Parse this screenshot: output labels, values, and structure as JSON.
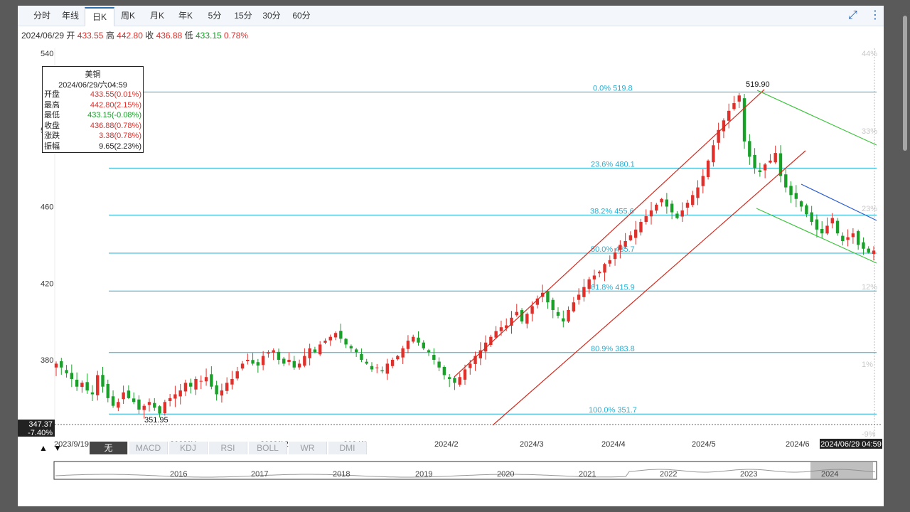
{
  "tabs": [
    {
      "label": "分时",
      "active": false
    },
    {
      "label": "年线",
      "active": false
    },
    {
      "label": "日K",
      "active": true
    },
    {
      "label": "周K",
      "active": false
    },
    {
      "label": "月K",
      "active": false
    },
    {
      "label": "年K",
      "active": false
    },
    {
      "label": "5分",
      "active": false
    },
    {
      "label": "15分",
      "active": false
    },
    {
      "label": "30分",
      "active": false
    },
    {
      "label": "60分",
      "active": false
    }
  ],
  "icons": {
    "collapse": "collapse-arrows-icon",
    "more": "vertical-dots-icon"
  },
  "info": {
    "date": "2024/06/29",
    "open_label": "开",
    "open": "433.55",
    "high_label": "高",
    "high": "442.80",
    "close_label": "收",
    "close": "436.88",
    "low_label": "低",
    "low": "433.15",
    "change": "0.78%"
  },
  "ohlc_box": {
    "title": "美铜",
    "datetime": "2024/06/29/六04:59",
    "rows": [
      {
        "k": "开盘",
        "v": "433.55(0.01%)",
        "color": "red"
      },
      {
        "k": "最高",
        "v": "442.80(2.15%)",
        "color": "red"
      },
      {
        "k": "最低",
        "v": "433.15(-0.08%)",
        "color": "green"
      },
      {
        "k": "收盘",
        "v": "436.88(0.78%)",
        "color": "red"
      },
      {
        "k": "涨跌",
        "v": "3.38(0.78%)",
        "color": "red"
      },
      {
        "k": "振幅",
        "v": "9.65(2.23%)",
        "color": "black"
      }
    ]
  },
  "colors": {
    "up": "#e0302b",
    "down": "#18a028",
    "fib": "#22b0d6",
    "channel_red": "#d42a1e",
    "channel_green": "#3cc43c",
    "channel_blue": "#2a5fd0"
  },
  "chart_data": {
    "type": "candlestick",
    "y_axis": {
      "ticks": [
        540,
        500,
        460,
        420,
        380
      ],
      "ylim": [
        341,
        547
      ]
    },
    "right_axis_ticks": [
      "44%",
      "33%",
      "23%",
      "12%",
      "1%",
      "-9%"
    ],
    "x_labels": [
      "2023/9/19",
      "2023/11",
      "2023/12",
      "2024/1",
      "2024/2",
      "2024/3",
      "2024/4",
      "2024/5",
      "2024/6"
    ],
    "crosshair": {
      "price": "347.37",
      "pct": "-7.40%",
      "date": "2024/06/29 04:59"
    },
    "annotations": {
      "high": "519.90",
      "low": "351.95"
    },
    "fibonacci": [
      {
        "label": "0.0% 519.8",
        "value": 519.8
      },
      {
        "label": "23.6% 480.1",
        "value": 480.1
      },
      {
        "label": "38.2% 455.6",
        "value": 455.6
      },
      {
        "label": "50.0% 435.7",
        "value": 435.7
      },
      {
        "label": "61.8% 415.9",
        "value": 415.9
      },
      {
        "label": "80.9% 383.8",
        "value": 383.8
      },
      {
        "label": "100.0% 351.7",
        "value": 351.7
      }
    ],
    "series_close": [
      378,
      376,
      373,
      370,
      366,
      368,
      364,
      362,
      372,
      366,
      360,
      356,
      358,
      363,
      360,
      358,
      354,
      356,
      358,
      355,
      352,
      358,
      360,
      362,
      364,
      368,
      366,
      370,
      369,
      371,
      366,
      362,
      364,
      368,
      370,
      374,
      378,
      380,
      378,
      377,
      382,
      384,
      385,
      380,
      378,
      380,
      376,
      378,
      382,
      386,
      384,
      388,
      390,
      392,
      394,
      391,
      388,
      386,
      384,
      380,
      378,
      375,
      376,
      374,
      378,
      380,
      382,
      386,
      390,
      392,
      389,
      386,
      384,
      380,
      376,
      372,
      370,
      368,
      371,
      375,
      378,
      382,
      385,
      389,
      392,
      395,
      397,
      398,
      402,
      405,
      400,
      404,
      408,
      412,
      415,
      410,
      406,
      403,
      400,
      406,
      410,
      414,
      418,
      422,
      424,
      426,
      430,
      432,
      436,
      440,
      442,
      445,
      448,
      452,
      455,
      458,
      461,
      464,
      460,
      457,
      454,
      458,
      462,
      466,
      470,
      476,
      484,
      492,
      500,
      505,
      510,
      514,
      518,
      494,
      486,
      480,
      478,
      482,
      484,
      488,
      476,
      470,
      466,
      464,
      460,
      456,
      452,
      448,
      446,
      450,
      454,
      446,
      442,
      444,
      446,
      440,
      438,
      436,
      437
    ],
    "overview": {
      "labels": [
        "2016",
        "2017",
        "2018",
        "2019",
        "2020",
        "2021",
        "2022",
        "2023",
        "2024"
      ]
    },
    "indicators": {
      "buttons": [
        "无",
        "MACD",
        "KDJ",
        "RSI",
        "BOLL",
        "WR",
        "DMI"
      ],
      "active": "无"
    },
    "channels": {
      "red_upper": [
        [
          639,
          530
        ],
        [
          1075,
          126
        ]
      ],
      "red_lower": [
        [
          693,
          598
        ],
        [
          1133,
          212
        ]
      ],
      "green_upper": [
        [
          1065,
          127
        ],
        [
          1233,
          204
        ]
      ],
      "green_lower": [
        [
          1064,
          293
        ],
        [
          1233,
          370
        ]
      ],
      "blue": [
        [
          1127,
          259
        ],
        [
          1233,
          310
        ]
      ]
    }
  }
}
